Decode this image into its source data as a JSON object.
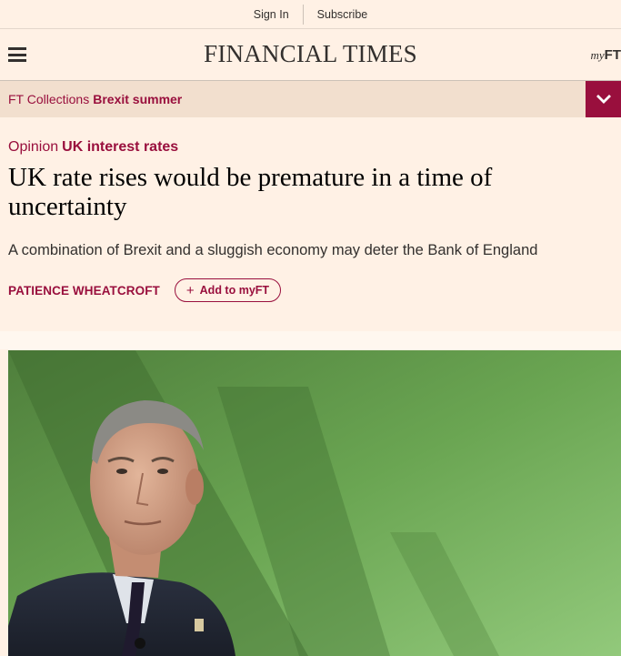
{
  "topbar": {
    "sign_in": "Sign In",
    "subscribe": "Subscribe"
  },
  "header": {
    "brand": "FINANCIAL TIMES",
    "myft_my": "my",
    "myft_ft": "FT",
    "menu_icon": "hamburger-icon"
  },
  "collections": {
    "label": "FT Collections",
    "value": "Brexit summer",
    "toggle_icon": "chevron-down-icon"
  },
  "article": {
    "kicker_label": "Opinion",
    "kicker_topic": "UK interest rates",
    "title": "UK rate rises would be premature in a time of uncertainty",
    "standfirst": "A combination of Brexit and a sluggish economy may deter the Bank of England",
    "author": "PATIENCE WHEATCROFT",
    "add_myft": "Add to myFT"
  },
  "colors": {
    "claret": "#990f3d",
    "paper": "#fff1e5",
    "band": "#f2dfce",
    "text": "#33302e"
  }
}
